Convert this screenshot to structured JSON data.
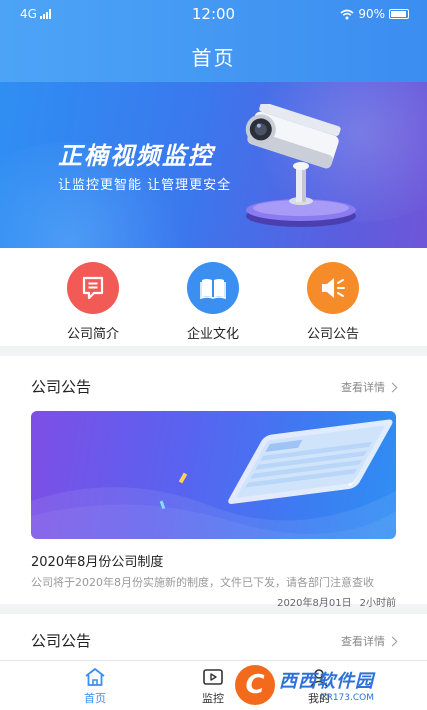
{
  "status_bar": {
    "network": "4G",
    "time": "12:00",
    "battery": "90%"
  },
  "header": {
    "title": "首页"
  },
  "banner": {
    "title": "正楠视频监控",
    "subtitle": "让监控更智能  让管理更安全"
  },
  "shortcuts": [
    {
      "label": "公司简介",
      "icon": "message-icon",
      "color": "#f25b55"
    },
    {
      "label": "企业文化",
      "icon": "book-icon",
      "color": "#3a8ff0"
    },
    {
      "label": "公司公告",
      "icon": "speaker-icon",
      "color": "#f68b2a"
    }
  ],
  "announcements": {
    "title": "公司公告",
    "more": "查看详情",
    "item": {
      "title": "2020年8月份公司制度",
      "desc": "公司将于2020年8月份实施新的制度，文件已下发，请各部门注意查收",
      "date": "2020年8月01日",
      "ago": "2小时前"
    }
  },
  "section2": {
    "title": "公司公告",
    "more": "查看详情"
  },
  "tabbar": [
    {
      "label": "首页",
      "icon": "home-icon",
      "active": true
    },
    {
      "label": "监控",
      "icon": "play-icon",
      "active": false
    },
    {
      "label": "我的",
      "icon": "user-icon",
      "active": false
    }
  ],
  "watermark": {
    "logo": "C",
    "text": "西西软件园",
    "url": "CR173.COM"
  },
  "colors": {
    "primary": "#3a8ff0",
    "background": "#f2f3f5"
  }
}
